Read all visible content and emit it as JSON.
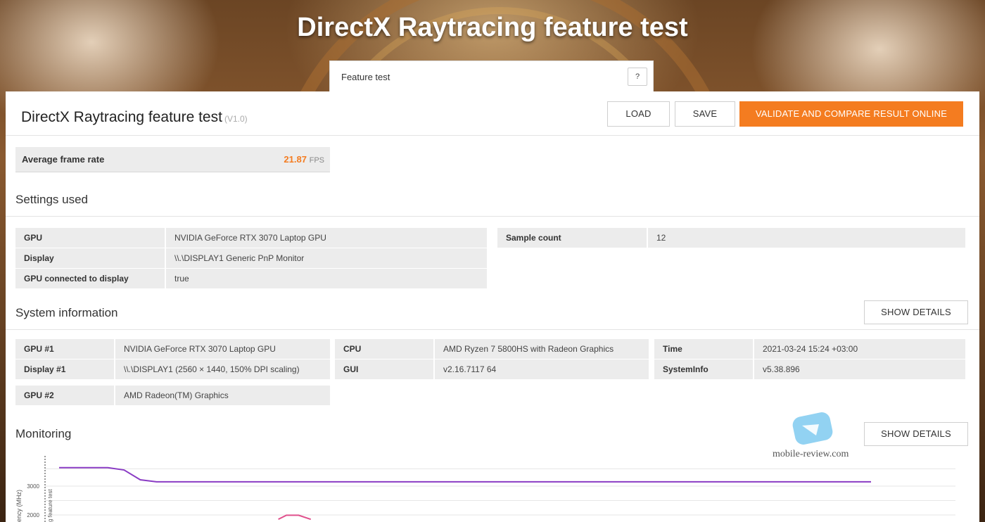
{
  "hero": {
    "title": "DirectX Raytracing feature test"
  },
  "feature_tab": {
    "label": "Feature test",
    "help": "?"
  },
  "header": {
    "title": "DirectX Raytracing feature test",
    "version": "(V1.0)",
    "load": "LOAD",
    "save": "SAVE",
    "validate": "VALIDATE AND COMPARE RESULT ONLINE"
  },
  "result": {
    "label": "Average frame rate",
    "value": "21.87",
    "unit": "FPS"
  },
  "settings": {
    "title": "Settings used",
    "rows": [
      {
        "k": "GPU",
        "v": "NVIDIA GeForce RTX 3070 Laptop GPU"
      },
      {
        "k": "Display",
        "v": "\\\\.\\DISPLAY1 Generic PnP Monitor"
      },
      {
        "k": "GPU connected to display",
        "v": "true"
      }
    ],
    "right": {
      "k": "Sample count",
      "v": "12"
    }
  },
  "system": {
    "title": "System information",
    "show_details": "SHOW DETAILS",
    "col1": [
      {
        "k": "GPU #1",
        "v": "NVIDIA GeForce RTX 3070 Laptop GPU"
      },
      {
        "k": "Display #1",
        "v": "\\\\.\\DISPLAY1 (2560 × 1440, 150% DPI scaling)"
      },
      {
        "k": "GPU #2",
        "v": "AMD Radeon(TM) Graphics"
      }
    ],
    "col2": [
      {
        "k": "CPU",
        "v": "AMD Ryzen 7 5800HS with Radeon Graphics"
      },
      {
        "k": "GUI",
        "v": "v2.16.7117 64"
      }
    ],
    "col3": [
      {
        "k": "Time",
        "v": "2021-03-24 15:24 +03:00"
      },
      {
        "k": "SystemInfo",
        "v": "v5.38.896"
      }
    ]
  },
  "monitoring": {
    "title": "Monitoring",
    "show_details": "SHOW DETAILS",
    "watermark": "mobile-review.com"
  },
  "chart_data": {
    "type": "line",
    "ylabel": "ency (MHz)",
    "marker_label": "g feature test",
    "y_ticks": [
      3000,
      2000
    ],
    "series": [
      {
        "color": "#8a3cc4",
        "x": [
          0,
          6,
          8,
          10,
          12,
          100
        ],
        "y": [
          3640,
          3640,
          3560,
          3220,
          3150,
          3150
        ]
      },
      {
        "color": "#e0508c",
        "x": [
          27,
          28,
          29.5,
          31
        ],
        "y": [
          1850,
          1990,
          1990,
          1850
        ]
      }
    ],
    "colors": {
      "accent": "#f47c20"
    }
  }
}
